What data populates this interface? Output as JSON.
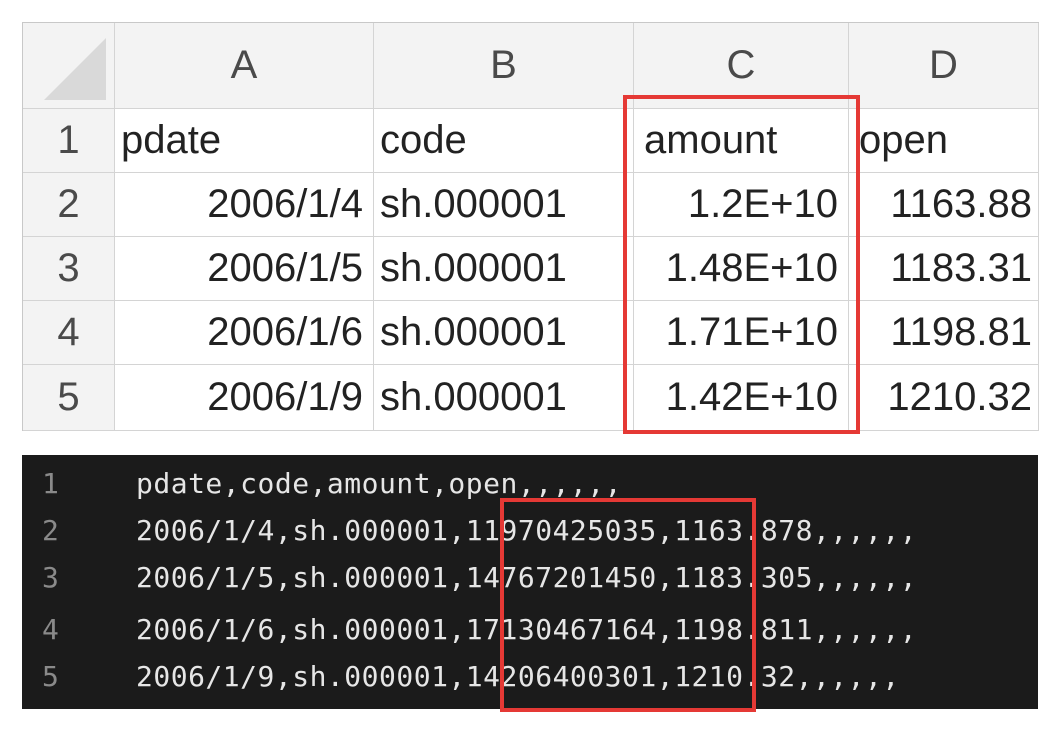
{
  "spreadsheet": {
    "column_headers": [
      "A",
      "B",
      "C",
      "D"
    ],
    "rows": [
      {
        "num": "1",
        "cells": [
          "pdate",
          "code",
          "amount",
          "open"
        ]
      },
      {
        "num": "2",
        "cells": [
          "2006/1/4",
          "sh.000001",
          "1.2E+10",
          "1163.88"
        ]
      },
      {
        "num": "3",
        "cells": [
          "2006/1/5",
          "sh.000001",
          "1.48E+10",
          "1183.31"
        ]
      },
      {
        "num": "4",
        "cells": [
          "2006/1/6",
          "sh.000001",
          "1.71E+10",
          "1198.81"
        ]
      },
      {
        "num": "5",
        "cells": [
          "2006/1/9",
          "sh.000001",
          "1.42E+10",
          "1210.32"
        ]
      }
    ]
  },
  "csv_view": {
    "lines": [
      {
        "num": "1",
        "text": "pdate,code,amount,open,,,,,,"
      },
      {
        "num": "2",
        "text": "2006/1/4,sh.000001,11970425035,1163.878,,,,,,"
      },
      {
        "num": "3",
        "text": "2006/1/5,sh.000001,14767201450,1183.305,,,,,,"
      },
      {
        "num": "4",
        "text": "2006/1/6,sh.000001,17130467164,1198.811,,,,,,"
      },
      {
        "num": "5",
        "text": "2006/1/9,sh.000001,14206400301,1210.32,,,,,,"
      }
    ]
  },
  "colors": {
    "highlight": "#e53935",
    "code_background": "#1b1b1b",
    "header_background": "#f3f3f3"
  }
}
